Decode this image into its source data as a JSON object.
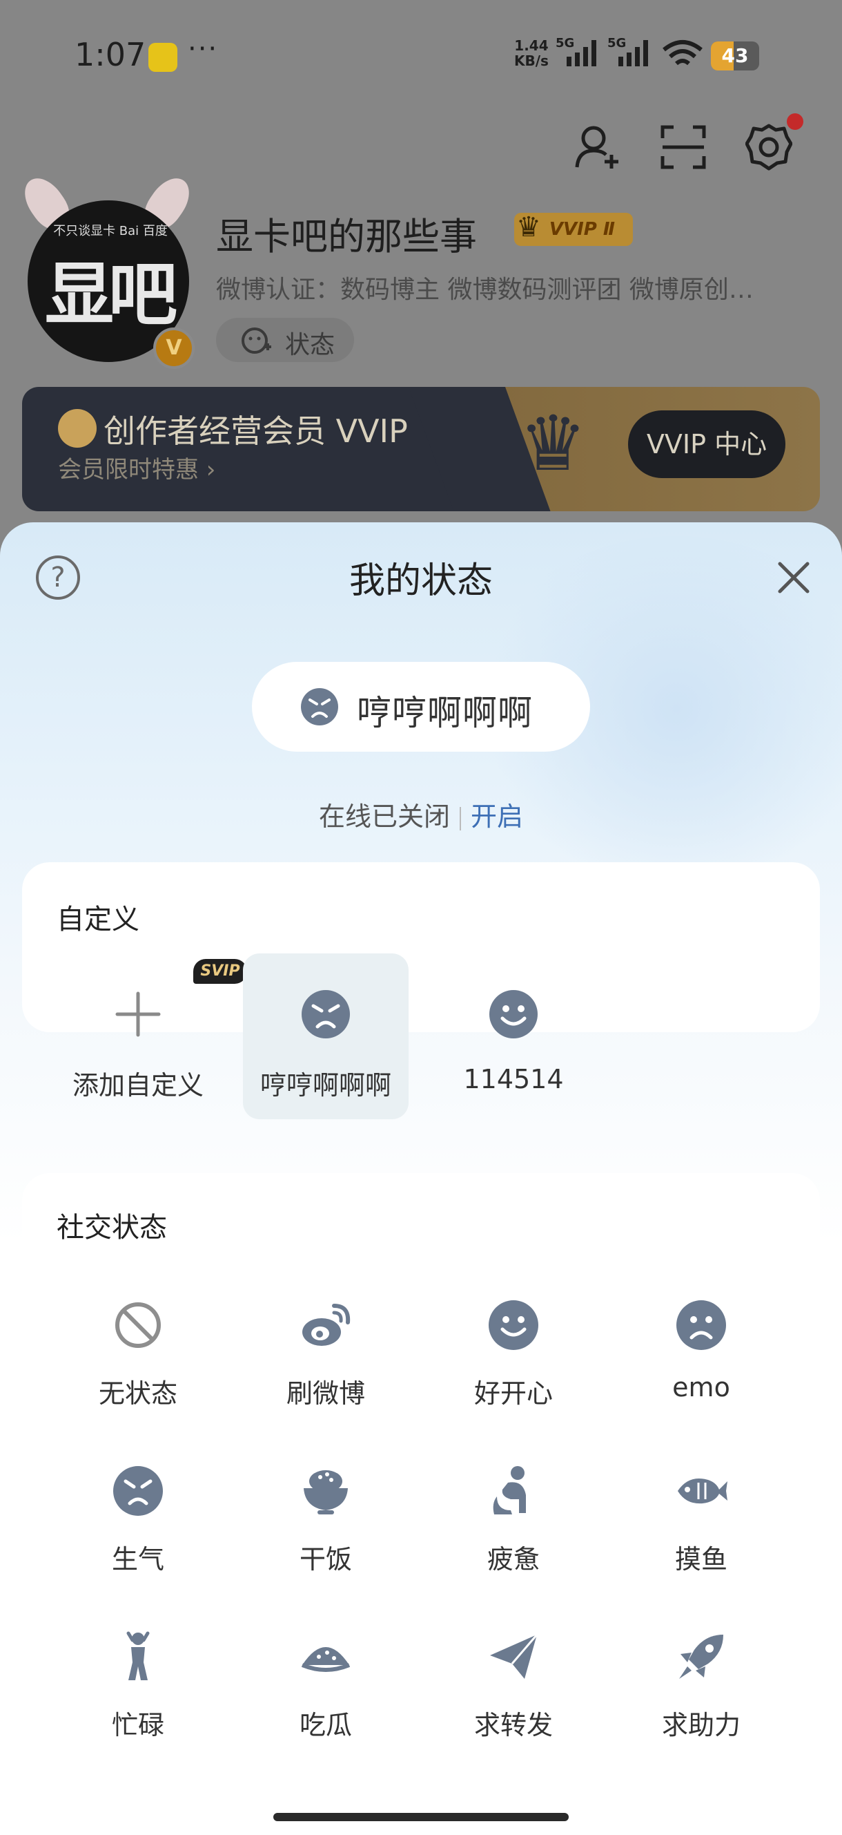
{
  "status_bar": {
    "time": "1:07",
    "more": "···",
    "net_speed_value": "1.44",
    "net_speed_unit": "KB/s",
    "signal1_label": "5G",
    "signal2_label": "5G",
    "battery": "43"
  },
  "profile": {
    "username": "显卡吧的那些事",
    "vvip_badge": "VVIP Ⅱ",
    "certification": "微博认证：数码博主 微博数码测评团 微博原创…",
    "status_chip": "状态",
    "avatar_text": "显吧",
    "avatar_caption": "不只谈显卡 Bai 百度",
    "verified_badge": "V"
  },
  "vvip_banner": {
    "title": "创作者经营会员 VVIP",
    "subtitle": "会员限时特惠 ›",
    "button": "VVIP 中心"
  },
  "sheet": {
    "title": "我的状态",
    "current_status": "哼哼啊啊啊",
    "online_text": "在线已关闭",
    "online_action": "开启"
  },
  "custom_section": {
    "title": "自定义",
    "items": [
      {
        "label": "添加自定义",
        "tag": "SVIP",
        "icon": "plus-icon"
      },
      {
        "label": "哼哼啊啊啊",
        "icon": "angry-face-icon",
        "selected": true
      },
      {
        "label": "114514",
        "icon": "smile-face-icon"
      }
    ]
  },
  "social_section": {
    "title": "社交状态",
    "items": [
      {
        "label": "无状态",
        "icon": "no-status-icon"
      },
      {
        "label": "刷微博",
        "icon": "weibo-icon"
      },
      {
        "label": "好开心",
        "icon": "happy-face-icon"
      },
      {
        "label": "emo",
        "icon": "sad-face-icon"
      },
      {
        "label": "生气",
        "icon": "angry-face-icon"
      },
      {
        "label": "干饭",
        "icon": "rice-bowl-icon"
      },
      {
        "label": "疲惫",
        "icon": "tired-person-icon"
      },
      {
        "label": "摸鱼",
        "icon": "fish-icon"
      },
      {
        "label": "忙碌",
        "icon": "busy-person-icon"
      },
      {
        "label": "吃瓜",
        "icon": "watermelon-icon"
      },
      {
        "label": "求转发",
        "icon": "paper-plane-icon"
      },
      {
        "label": "求助力",
        "icon": "rocket-icon"
      }
    ]
  },
  "colors": {
    "icon_gray": "#6b7a8f",
    "link_blue": "#3d6fb5",
    "selected_bg": "#e9f0f3",
    "dim_overlay": "#868686"
  }
}
